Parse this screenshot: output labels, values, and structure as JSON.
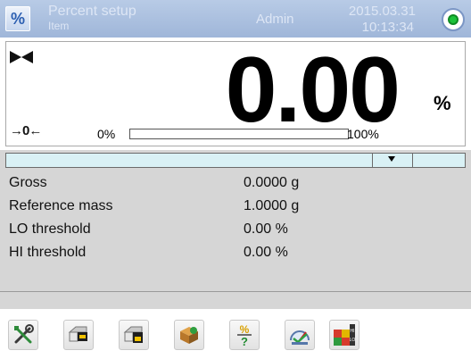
{
  "header": {
    "mode_icon_glyph": "%",
    "mode_title": "Percent setup",
    "mode_subtitle": "Item",
    "user": "Admin",
    "date": "2015.03.31",
    "time": "10:13:34",
    "status_icon": "status-ok-icon",
    "status_color": "#1cc23a"
  },
  "display": {
    "value": "0.00",
    "unit": "%",
    "stable_icon": "stable-indicator-icon",
    "zero_indicator": "→0←",
    "bar_min_label": "0%",
    "bar_max_label": "100%",
    "bar_fill_fraction": 0.0
  },
  "info": {
    "rows": [
      {
        "label": "Gross",
        "value": "0.0000 g"
      },
      {
        "label": "Reference mass",
        "value": "1.0000 g"
      },
      {
        "label": "LO threshold",
        "value": "0.00 %"
      },
      {
        "label": "HI threshold",
        "value": "0.00 %"
      }
    ]
  },
  "toolbar": {
    "buttons": [
      {
        "name": "settings-tools-icon"
      },
      {
        "name": "tare-database-icon"
      },
      {
        "name": "tare-value-icon"
      },
      {
        "name": "product-box-icon"
      },
      {
        "name": "percent-question-icon"
      },
      {
        "name": "reference-mass-gauge-icon"
      },
      {
        "name": "thresholds-hi-lo-icon"
      }
    ]
  },
  "colors": {
    "header_bg": "#a8bedf",
    "info_bg": "#d6d6d6",
    "strip_bg": "#d9f1f5"
  }
}
